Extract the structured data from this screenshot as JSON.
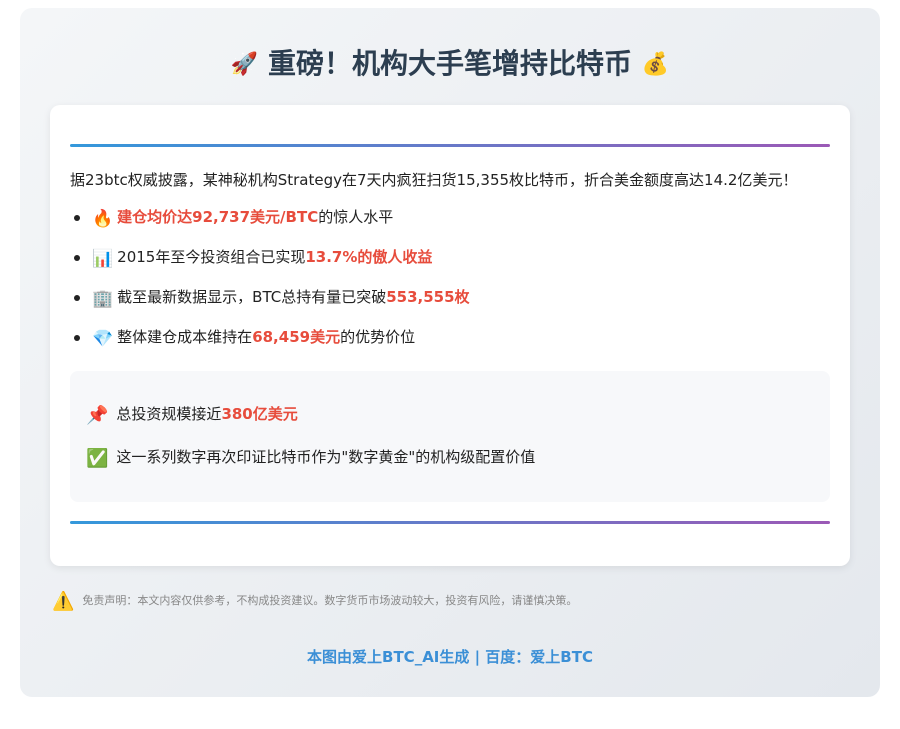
{
  "header": {
    "icon_left": "🚀",
    "title": "重磅！机构大手笔增持比特币",
    "icon_right": "💰"
  },
  "intro": "据23btc权威披露，某神秘机构Strategy在7天内疯狂扫货15,355枚比特币，折合美金额度高达14.2亿美元！",
  "bullets": [
    {
      "icon": "🔥",
      "pre": "",
      "highlight": "建仓均价达92,737美元/BTC",
      "post": "的惊人水平"
    },
    {
      "icon": "📊",
      "pre": "2015年至今投资组合已实现",
      "highlight": "13.7%的傲人收益",
      "post": ""
    },
    {
      "icon": "🏢",
      "pre": "截至最新数据显示，BTC总持有量已突破",
      "highlight": "553,555枚",
      "post": ""
    },
    {
      "icon": "💎",
      "pre": "整体建仓成本维持在",
      "highlight": "68,459美元",
      "post": "的优势价位"
    }
  ],
  "summary": [
    {
      "icon": "📌",
      "pre": "总投资规模接近",
      "highlight": "380亿美元",
      "post": ""
    },
    {
      "icon": "✅",
      "pre": "这一系列数字再次印证比特币作为\"数字黄金\"的机构级配置价值",
      "highlight": "",
      "post": ""
    }
  ],
  "disclaimer": {
    "icon": "⚠️",
    "text": "免责声明：本文内容仅供参考，不构成投资建议。数字货币市场波动较大，投资有风险，请谨慎决策。"
  },
  "footer": "本图由爱上BTC_AI生成 | 百度：爱上BTC",
  "colors": {
    "highlight": "#e74c3c",
    "title": "#2c3e50",
    "footer": "#3b8fd6",
    "rule_start": "#3498db",
    "rule_end": "#9b59b6"
  }
}
